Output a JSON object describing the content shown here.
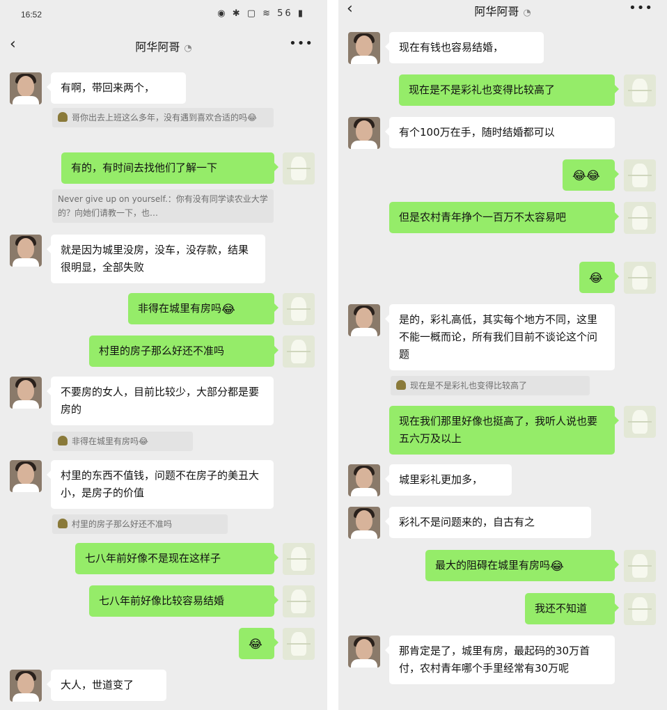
{
  "left": {
    "status": {
      "time": "16:52",
      "icons": "◉ ✱ ▢ ≋ 56 ▮"
    },
    "title": "阿华阿哥",
    "messages": [
      {
        "text": "有啊，带回来两个，"
      },
      {
        "quote": "哥你出去上班这么多年，没有遇到喜欢合适的吗😂"
      },
      {
        "text": "有的，有时间去找他们了解一下"
      },
      {
        "quote": "Never give up on yourself.：你有没有同学读农业大学的？向她们请教一下，也…"
      },
      {
        "text": "就是因为城里没房，没车，没存款，结果很明显，全部失败"
      },
      {
        "text": "非得在城里有房吗",
        "emoji": "😂"
      },
      {
        "text": "村里的房子那么好还不准吗"
      },
      {
        "text": "不要房的女人，目前比较少，大部分都是要房的"
      },
      {
        "quote": "非得在城里有房吗😂"
      },
      {
        "text": "村里的东西不值钱，问题不在房子的美丑大小，是房子的价值"
      },
      {
        "quote": "村里的房子那么好还不准吗"
      },
      {
        "text": "七八年前好像不是现在这样子"
      },
      {
        "text": "七八年前好像比较容易结婚"
      },
      {
        "emoji": "😂"
      },
      {
        "text": "大人，世道变了"
      }
    ]
  },
  "right": {
    "title": "阿华阿哥",
    "messages": [
      {
        "text": "现在有钱也容易结婚，"
      },
      {
        "text": "现在是不是彩礼也变得比较高了"
      },
      {
        "text": "有个100万在手，随时结婚都可以"
      },
      {
        "emoji": "😂😂"
      },
      {
        "text": "但是农村青年挣个一百万不太容易吧"
      },
      {
        "emoji": "😂"
      },
      {
        "text": "是的，彩礼高低，其实每个地方不同，这里不能一概而论，所有我们目前不谈论这个问题"
      },
      {
        "quote": "现在是不是彩礼也变得比较高了"
      },
      {
        "text": "现在我们那里好像也挺高了，我听人说也要五六万及以上"
      },
      {
        "text": "城里彩礼更加多，"
      },
      {
        "text": "彩礼不是问题来的，自古有之"
      },
      {
        "text": "最大的阻碍在城里有房吗",
        "emoji": "😂"
      },
      {
        "text": "我还不知道"
      },
      {
        "text": "那肯定是了，城里有房，最起码的30万首付，农村青年哪个手里经常有30万呢"
      }
    ]
  }
}
